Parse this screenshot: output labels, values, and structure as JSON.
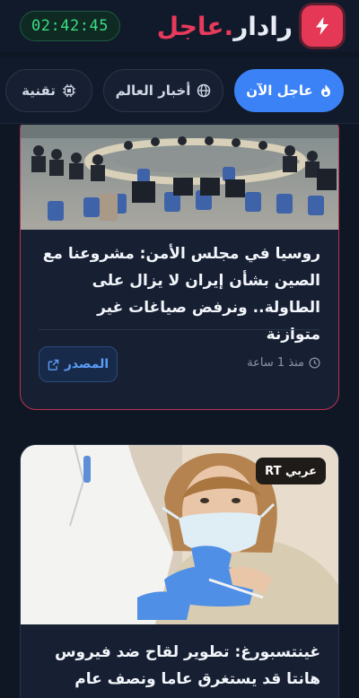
{
  "header": {
    "clock": "02:42:45",
    "brand_part1": "رادار",
    "brand_dot": ".",
    "brand_part2": "عاجل",
    "logo_icon": "lightning-icon",
    "accent": "#e53856"
  },
  "tabs": [
    {
      "label": "عاجل الآن",
      "icon": "flame-icon",
      "active": true
    },
    {
      "label": "أخبار العالم",
      "icon": "globe-icon",
      "active": false
    },
    {
      "label": "تقنية",
      "icon": "chip-icon",
      "active": false
    }
  ],
  "articles": [
    {
      "title": "روسيا في مجلس الأمن: مشروعنا مع الصين بشأن إيران لا يزال على الطاولة.. ونرفض صياغات غير متوازنة",
      "time": "منذ 1 ساعة",
      "source_label": "المصدر",
      "image": "security-council-photo"
    },
    {
      "title": "غينتسبورغ: تطوير لقاح ضد فيروس هانتا قد يستغرق عاما ونصف عام",
      "badge": "RT عربي",
      "image": "vaccination-photo"
    }
  ]
}
